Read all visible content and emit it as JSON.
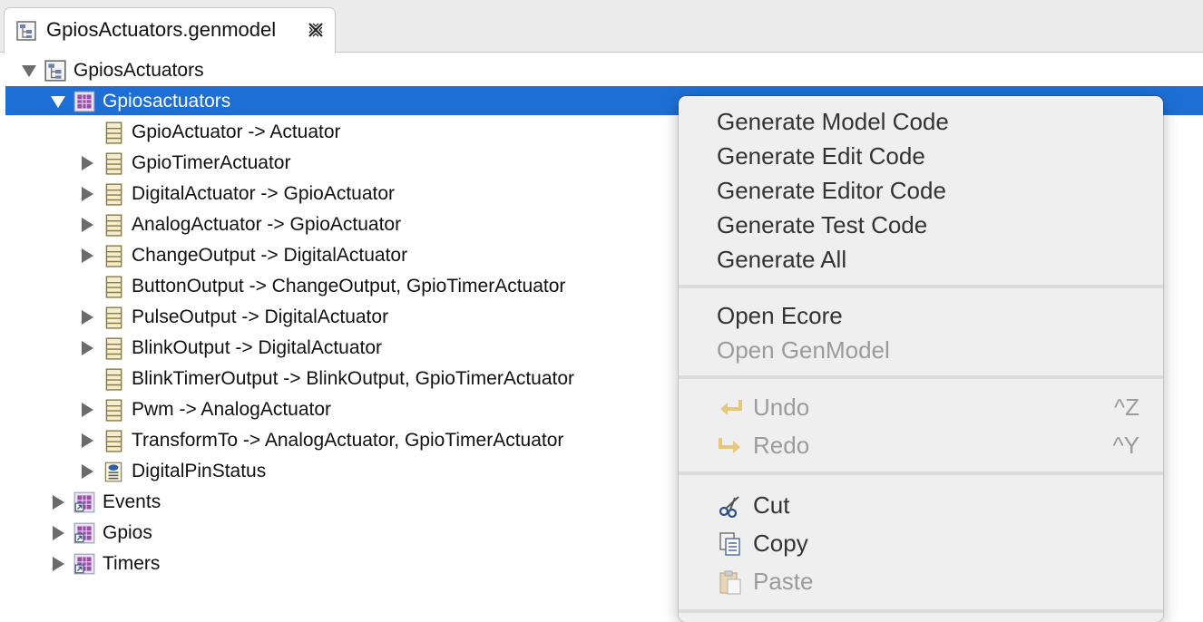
{
  "editor_tab": {
    "title": "GpiosActuators.genmodel",
    "close_icon": "close-x-icon"
  },
  "tree": {
    "root": {
      "label": "GpiosActuators",
      "icon": "genmodel-icon"
    },
    "selected_package": {
      "label": "Gpiosactuators",
      "icon": "genpackage-icon"
    },
    "classes": [
      {
        "label": "GpioActuator -> Actuator",
        "expandable": false
      },
      {
        "label": "GpioTimerActuator",
        "expandable": true
      },
      {
        "label": "DigitalActuator -> GpioActuator",
        "expandable": true
      },
      {
        "label": "AnalogActuator -> GpioActuator",
        "expandable": true
      },
      {
        "label": "ChangeOutput -> DigitalActuator",
        "expandable": true
      },
      {
        "label": "ButtonOutput -> ChangeOutput, GpioTimerActuator",
        "expandable": false
      },
      {
        "label": "PulseOutput -> DigitalActuator",
        "expandable": true
      },
      {
        "label": "BlinkOutput -> DigitalActuator",
        "expandable": true
      },
      {
        "label": "BlinkTimerOutput -> BlinkOutput, GpioTimerActuator",
        "expandable": false
      },
      {
        "label": "Pwm -> AnalogActuator",
        "expandable": true
      },
      {
        "label": "TransformTo -> AnalogActuator, GpioTimerActuator",
        "expandable": true
      }
    ],
    "enum_item": {
      "label": "DigitalPinStatus",
      "icon": "enum-icon"
    },
    "packages": [
      {
        "label": "Events"
      },
      {
        "label": "Gpios"
      },
      {
        "label": "Timers"
      }
    ]
  },
  "context_menu": {
    "generate": [
      {
        "label": "Generate Model Code"
      },
      {
        "label": "Generate Edit Code"
      },
      {
        "label": "Generate Editor Code"
      },
      {
        "label": "Generate Test Code"
      },
      {
        "label": "Generate All"
      }
    ],
    "open": [
      {
        "label": "Open Ecore",
        "enabled": true
      },
      {
        "label": "Open GenModel",
        "enabled": false
      }
    ],
    "undo": {
      "label": "Undo",
      "shortcut": "^Z",
      "icon": "undo-arrow-icon"
    },
    "redo": {
      "label": "Redo",
      "shortcut": "^Y",
      "icon": "redo-arrow-icon"
    },
    "cut": {
      "label": "Cut",
      "icon": "scissors-icon"
    },
    "copy": {
      "label": "Copy",
      "icon": "copy-icon"
    },
    "paste": {
      "label": "Paste",
      "icon": "paste-icon"
    }
  },
  "colors": {
    "selection": "#1d6fd6",
    "menu_bg": "#efefef",
    "disabled_text": "#9b9b9b"
  }
}
